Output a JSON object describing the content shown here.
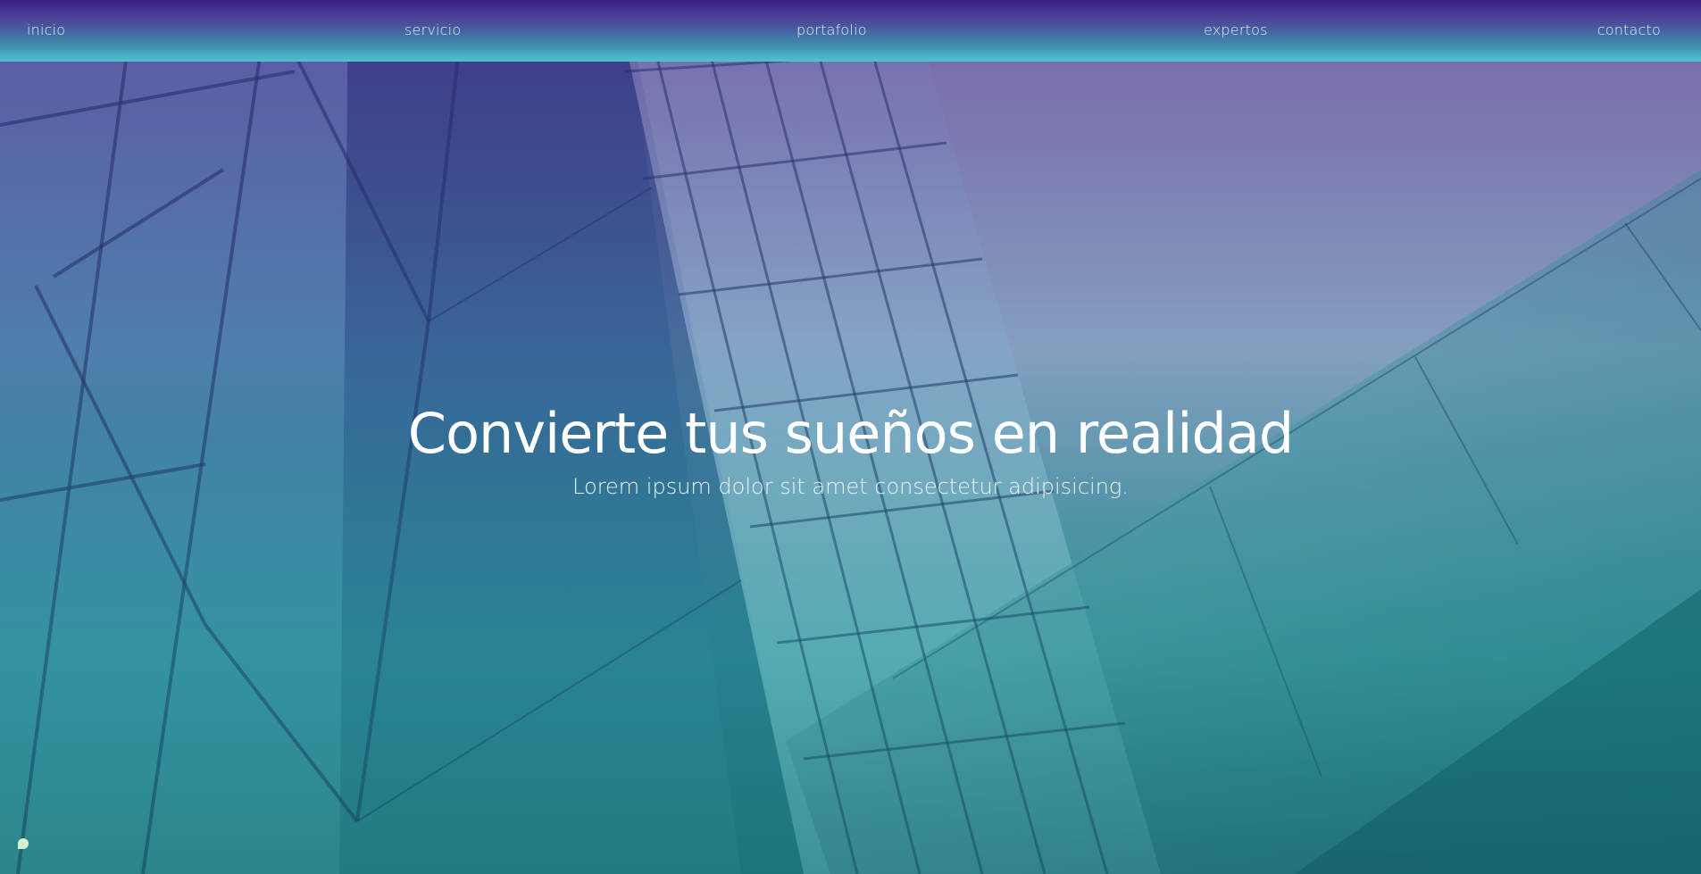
{
  "nav": {
    "items": [
      {
        "label": "inicio"
      },
      {
        "label": "servicio"
      },
      {
        "label": "portafolio"
      },
      {
        "label": "expertos"
      },
      {
        "label": "contacto"
      }
    ]
  },
  "hero": {
    "title": "Convierte tus sueños en realidad",
    "subtitle": "Lorem ipsum dolor sit amet consectetur adipisicing.",
    "background_image": "building-facade-glass",
    "colors": {
      "nav_top": "#3d1f86",
      "nav_bottom": "#4ec4cf",
      "sky": "#8f85b8",
      "teal_dark": "#1e6a72",
      "text": "#ffffff"
    }
  }
}
